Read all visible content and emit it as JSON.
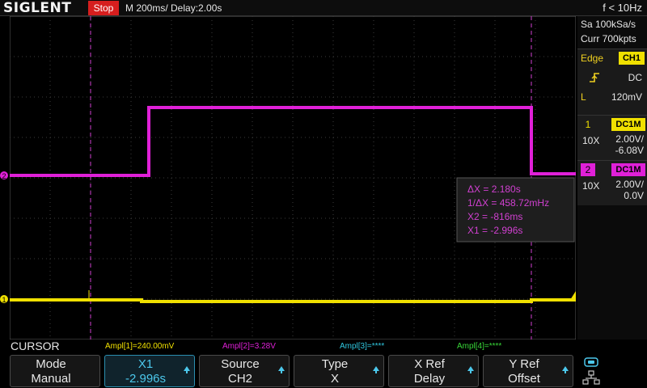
{
  "header": {
    "brand": "SIGLENT",
    "run_state": "Stop",
    "timebase": "M 200ms/  Delay:2.00s",
    "frequency": "f < 10Hz"
  },
  "acquisition": {
    "sample_rate": "Sa 100kSa/s",
    "memory": "Curr 700kpts"
  },
  "trigger": {
    "type": "Edge",
    "source": "CH1",
    "slope_icon": "rising-edge-icon",
    "coupling": "DC",
    "level_label": "L",
    "level": "120mV"
  },
  "channels": [
    {
      "number": "1",
      "coupling": "DC1M",
      "probe": "10X",
      "scale": "2.00V/",
      "offset": "-6.08V",
      "color": "#f0e000"
    },
    {
      "number": "2",
      "coupling": "DC1M",
      "probe": "10X",
      "scale": "2.00V/",
      "offset": "0.0V",
      "color": "#e020d8"
    }
  ],
  "markers": {
    "ch1": "1",
    "ch2": "2"
  },
  "cursor_readout": {
    "delta_x": "ΔX = 2.180s",
    "inv_delta_x": "1/ΔX = 458.72mHz",
    "x2": "X2 = -816ms",
    "x1": "X1 = -2.996s"
  },
  "status": {
    "menu_title": "CURSOR",
    "ampl1": "Ampl[1]=240.00mV",
    "ampl2": "Ampl[2]=3.28V",
    "ampl3": "Ampl[3]=****",
    "ampl4": "Ampl[4]=****"
  },
  "softkeys": [
    {
      "line1": "Mode",
      "line2": "Manual",
      "active": false,
      "knob": false
    },
    {
      "line1": "X1",
      "line2": "-2.996s",
      "active": true,
      "knob": true
    },
    {
      "line1": "Source",
      "line2": "CH2",
      "active": false,
      "knob": true
    },
    {
      "line1": "Type",
      "line2": "X",
      "active": false,
      "knob": true
    },
    {
      "line1": "X Ref",
      "line2": "Delay",
      "active": false,
      "knob": true
    },
    {
      "line1": "Y Ref",
      "line2": "Offset",
      "active": false,
      "knob": true
    }
  ],
  "colors": {
    "ch1": "#f0e000",
    "ch2": "#e020d8",
    "cursor": "#d040d0",
    "grid": "#3c3c3c",
    "active_softkey": "#4cc8ec"
  }
}
